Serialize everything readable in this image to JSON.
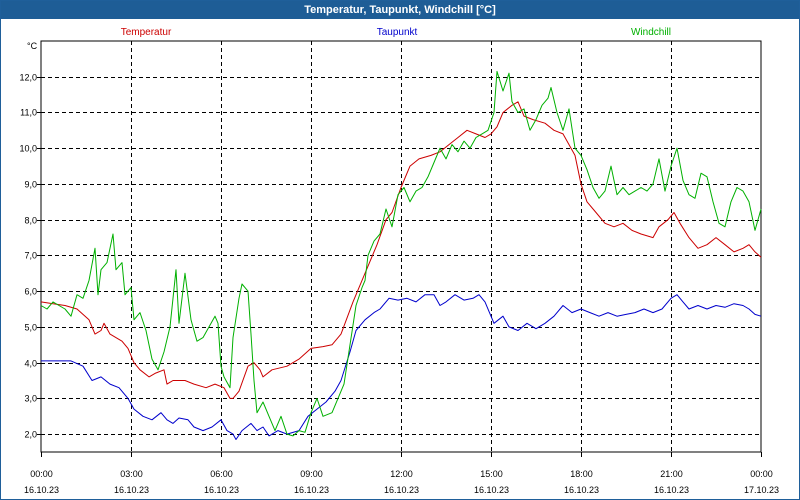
{
  "window": {
    "title": "Temperatur, Taupunkt, Windchill [°C]"
  },
  "chart_data": {
    "type": "line",
    "title": "Temperatur, Taupunkt, Windchill [°C]",
    "ylabel": "°C",
    "ylim": [
      1.5,
      13.0
    ],
    "xlim": [
      0,
      24
    ],
    "yticks": [
      2.0,
      3.0,
      4.0,
      5.0,
      6.0,
      7.0,
      8.0,
      9.0,
      10.0,
      11.0,
      12.0
    ],
    "ytick_labels": [
      "2,0",
      "3,0",
      "4,0",
      "5,0",
      "6,0",
      "7,0",
      "8,0",
      "9,0",
      "10,0",
      "11,0",
      "12,0"
    ],
    "xticks": [
      {
        "x": 0,
        "time": "00:00",
        "date": "16.10.23"
      },
      {
        "x": 3,
        "time": "03:00",
        "date": "16.10.23"
      },
      {
        "x": 6,
        "time": "06:00",
        "date": "16.10.23"
      },
      {
        "x": 9,
        "time": "09:00",
        "date": "16.10.23"
      },
      {
        "x": 12,
        "time": "12:00",
        "date": "16.10.23"
      },
      {
        "x": 15,
        "time": "15:00",
        "date": "16.10.23"
      },
      {
        "x": 18,
        "time": "18:00",
        "date": "16.10.23"
      },
      {
        "x": 21,
        "time": "21:00",
        "date": "16.10.23"
      },
      {
        "x": 24,
        "time": "00:00",
        "date": "17.10.23"
      }
    ],
    "grid": true,
    "legend_position": "top",
    "series": [
      {
        "name": "Temperatur",
        "color": "#cc0000",
        "points": [
          [
            0,
            5.7
          ],
          [
            0.4,
            5.65
          ],
          [
            0.8,
            5.6
          ],
          [
            1.2,
            5.5
          ],
          [
            1.6,
            5.2
          ],
          [
            1.7,
            5.0
          ],
          [
            1.8,
            4.8
          ],
          [
            2.0,
            4.9
          ],
          [
            2.1,
            5.1
          ],
          [
            2.3,
            4.8
          ],
          [
            2.7,
            4.6
          ],
          [
            2.9,
            4.4
          ],
          [
            3.1,
            4.0
          ],
          [
            3.3,
            3.8
          ],
          [
            3.6,
            3.6
          ],
          [
            3.8,
            3.7
          ],
          [
            4.1,
            3.8
          ],
          [
            4.2,
            3.4
          ],
          [
            4.4,
            3.5
          ],
          [
            4.8,
            3.5
          ],
          [
            5.1,
            3.4
          ],
          [
            5.5,
            3.3
          ],
          [
            5.8,
            3.4
          ],
          [
            6.1,
            3.3
          ],
          [
            6.3,
            3.0
          ],
          [
            6.4,
            3.0
          ],
          [
            6.6,
            3.2
          ],
          [
            6.9,
            3.9
          ],
          [
            7.1,
            4.0
          ],
          [
            7.3,
            3.8
          ],
          [
            7.4,
            3.6
          ],
          [
            7.7,
            3.8
          ],
          [
            8.2,
            3.9
          ],
          [
            8.6,
            4.1
          ],
          [
            9.0,
            4.4
          ],
          [
            9.4,
            4.45
          ],
          [
            9.7,
            4.5
          ],
          [
            10.0,
            4.8
          ],
          [
            10.4,
            5.7
          ],
          [
            10.8,
            6.5
          ],
          [
            11.2,
            7.3
          ],
          [
            11.5,
            8.0
          ],
          [
            11.7,
            8.2
          ],
          [
            12.0,
            8.9
          ],
          [
            12.3,
            9.5
          ],
          [
            12.6,
            9.7
          ],
          [
            13.0,
            9.8
          ],
          [
            13.3,
            9.9
          ],
          [
            13.6,
            10.1
          ],
          [
            13.9,
            10.3
          ],
          [
            14.2,
            10.5
          ],
          [
            14.5,
            10.4
          ],
          [
            14.8,
            10.3
          ],
          [
            15.0,
            10.4
          ],
          [
            15.2,
            10.6
          ],
          [
            15.4,
            11.0
          ],
          [
            15.7,
            11.2
          ],
          [
            15.9,
            11.3
          ],
          [
            16.1,
            10.9
          ],
          [
            16.4,
            10.8
          ],
          [
            16.8,
            10.7
          ],
          [
            17.1,
            10.5
          ],
          [
            17.4,
            10.4
          ],
          [
            17.6,
            10.1
          ],
          [
            17.8,
            9.8
          ],
          [
            18.0,
            9.0
          ],
          [
            18.2,
            8.5
          ],
          [
            18.5,
            8.2
          ],
          [
            18.8,
            7.9
          ],
          [
            19.1,
            7.8
          ],
          [
            19.4,
            7.9
          ],
          [
            19.7,
            7.7
          ],
          [
            20.0,
            7.6
          ],
          [
            20.4,
            7.5
          ],
          [
            20.6,
            7.8
          ],
          [
            20.9,
            8.0
          ],
          [
            21.1,
            8.2
          ],
          [
            21.3,
            7.9
          ],
          [
            21.6,
            7.5
          ],
          [
            21.9,
            7.2
          ],
          [
            22.2,
            7.3
          ],
          [
            22.5,
            7.5
          ],
          [
            22.8,
            7.3
          ],
          [
            23.1,
            7.1
          ],
          [
            23.4,
            7.2
          ],
          [
            23.6,
            7.3
          ],
          [
            23.8,
            7.1
          ],
          [
            24.0,
            6.95
          ]
        ]
      },
      {
        "name": "Taupunkt",
        "color": "#0000cc",
        "points": [
          [
            0,
            4.05
          ],
          [
            0.5,
            4.05
          ],
          [
            1.0,
            4.05
          ],
          [
            1.4,
            3.9
          ],
          [
            1.7,
            3.5
          ],
          [
            2.0,
            3.6
          ],
          [
            2.3,
            3.4
          ],
          [
            2.6,
            3.3
          ],
          [
            2.9,
            3.0
          ],
          [
            3.1,
            2.7
          ],
          [
            3.4,
            2.5
          ],
          [
            3.7,
            2.4
          ],
          [
            4.0,
            2.6
          ],
          [
            4.2,
            2.4
          ],
          [
            4.4,
            2.3
          ],
          [
            4.6,
            2.45
          ],
          [
            4.9,
            2.4
          ],
          [
            5.1,
            2.2
          ],
          [
            5.4,
            2.1
          ],
          [
            5.7,
            2.2
          ],
          [
            6.0,
            2.4
          ],
          [
            6.2,
            2.1
          ],
          [
            6.4,
            2.0
          ],
          [
            6.5,
            1.85
          ],
          [
            6.7,
            2.1
          ],
          [
            7.0,
            2.3
          ],
          [
            7.2,
            2.1
          ],
          [
            7.4,
            2.2
          ],
          [
            7.6,
            1.95
          ],
          [
            7.9,
            2.1
          ],
          [
            8.2,
            2.0
          ],
          [
            8.6,
            2.1
          ],
          [
            8.9,
            2.5
          ],
          [
            9.2,
            2.7
          ],
          [
            9.5,
            2.9
          ],
          [
            9.8,
            3.2
          ],
          [
            10.0,
            3.5
          ],
          [
            10.3,
            4.3
          ],
          [
            10.5,
            4.9
          ],
          [
            10.8,
            5.2
          ],
          [
            11.1,
            5.4
          ],
          [
            11.3,
            5.5
          ],
          [
            11.6,
            5.8
          ],
          [
            11.9,
            5.75
          ],
          [
            12.2,
            5.8
          ],
          [
            12.5,
            5.7
          ],
          [
            12.8,
            5.9
          ],
          [
            13.1,
            5.9
          ],
          [
            13.3,
            5.6
          ],
          [
            13.5,
            5.7
          ],
          [
            13.8,
            5.9
          ],
          [
            14.1,
            5.75
          ],
          [
            14.4,
            5.8
          ],
          [
            14.6,
            5.9
          ],
          [
            14.8,
            5.7
          ],
          [
            15.1,
            5.1
          ],
          [
            15.4,
            5.3
          ],
          [
            15.6,
            5.0
          ],
          [
            15.9,
            4.9
          ],
          [
            16.2,
            5.1
          ],
          [
            16.5,
            4.95
          ],
          [
            16.8,
            5.1
          ],
          [
            17.1,
            5.3
          ],
          [
            17.4,
            5.6
          ],
          [
            17.7,
            5.4
          ],
          [
            18.0,
            5.5
          ],
          [
            18.3,
            5.4
          ],
          [
            18.6,
            5.3
          ],
          [
            18.9,
            5.4
          ],
          [
            19.2,
            5.3
          ],
          [
            19.5,
            5.35
          ],
          [
            19.8,
            5.4
          ],
          [
            20.1,
            5.5
          ],
          [
            20.4,
            5.4
          ],
          [
            20.7,
            5.5
          ],
          [
            21.0,
            5.8
          ],
          [
            21.2,
            5.9
          ],
          [
            21.4,
            5.7
          ],
          [
            21.6,
            5.5
          ],
          [
            21.9,
            5.6
          ],
          [
            22.2,
            5.5
          ],
          [
            22.5,
            5.6
          ],
          [
            22.8,
            5.55
          ],
          [
            23.1,
            5.65
          ],
          [
            23.4,
            5.6
          ],
          [
            23.6,
            5.5
          ],
          [
            23.8,
            5.35
          ],
          [
            24.0,
            5.3
          ]
        ]
      },
      {
        "name": "Windchill",
        "color": "#00b000",
        "points": [
          [
            0,
            5.6
          ],
          [
            0.2,
            5.5
          ],
          [
            0.4,
            5.7
          ],
          [
            0.6,
            5.6
          ],
          [
            0.8,
            5.5
          ],
          [
            1.0,
            5.3
          ],
          [
            1.2,
            5.9
          ],
          [
            1.4,
            5.8
          ],
          [
            1.6,
            6.3
          ],
          [
            1.8,
            7.2
          ],
          [
            1.9,
            5.9
          ],
          [
            2.0,
            6.6
          ],
          [
            2.2,
            6.8
          ],
          [
            2.4,
            7.6
          ],
          [
            2.5,
            6.6
          ],
          [
            2.7,
            6.8
          ],
          [
            2.8,
            5.9
          ],
          [
            3.0,
            6.1
          ],
          [
            3.1,
            5.2
          ],
          [
            3.3,
            5.4
          ],
          [
            3.5,
            4.9
          ],
          [
            3.7,
            4.1
          ],
          [
            3.9,
            3.8
          ],
          [
            4.1,
            4.3
          ],
          [
            4.3,
            5.0
          ],
          [
            4.5,
            6.6
          ],
          [
            4.6,
            5.1
          ],
          [
            4.8,
            6.5
          ],
          [
            5.0,
            5.2
          ],
          [
            5.2,
            4.6
          ],
          [
            5.4,
            4.7
          ],
          [
            5.6,
            5.0
          ],
          [
            5.8,
            5.3
          ],
          [
            5.9,
            5.1
          ],
          [
            6.0,
            3.9
          ],
          [
            6.1,
            3.6
          ],
          [
            6.3,
            3.3
          ],
          [
            6.4,
            4.7
          ],
          [
            6.6,
            5.8
          ],
          [
            6.7,
            6.2
          ],
          [
            6.9,
            6.0
          ],
          [
            7.0,
            4.8
          ],
          [
            7.1,
            3.5
          ],
          [
            7.2,
            2.6
          ],
          [
            7.4,
            2.9
          ],
          [
            7.6,
            2.5
          ],
          [
            7.8,
            2.1
          ],
          [
            8.0,
            2.5
          ],
          [
            8.2,
            2.0
          ],
          [
            8.4,
            1.95
          ],
          [
            8.6,
            2.1
          ],
          [
            8.8,
            2.05
          ],
          [
            9.0,
            2.6
          ],
          [
            9.2,
            3.0
          ],
          [
            9.4,
            2.5
          ],
          [
            9.7,
            2.6
          ],
          [
            9.9,
            3.0
          ],
          [
            10.1,
            3.4
          ],
          [
            10.3,
            4.5
          ],
          [
            10.5,
            5.6
          ],
          [
            10.7,
            6.1
          ],
          [
            10.8,
            6.3
          ],
          [
            10.9,
            7.0
          ],
          [
            11.1,
            7.4
          ],
          [
            11.3,
            7.6
          ],
          [
            11.5,
            8.3
          ],
          [
            11.7,
            7.8
          ],
          [
            11.9,
            8.7
          ],
          [
            12.1,
            8.9
          ],
          [
            12.3,
            8.5
          ],
          [
            12.5,
            8.8
          ],
          [
            12.7,
            8.9
          ],
          [
            12.9,
            9.2
          ],
          [
            13.1,
            9.6
          ],
          [
            13.3,
            10.0
          ],
          [
            13.5,
            9.7
          ],
          [
            13.7,
            10.1
          ],
          [
            13.9,
            9.9
          ],
          [
            14.1,
            10.2
          ],
          [
            14.3,
            10.0
          ],
          [
            14.5,
            10.3
          ],
          [
            14.7,
            10.4
          ],
          [
            14.9,
            10.5
          ],
          [
            15.1,
            11.0
          ],
          [
            15.2,
            12.15
          ],
          [
            15.4,
            11.6
          ],
          [
            15.6,
            12.1
          ],
          [
            15.7,
            11.3
          ],
          [
            15.9,
            11.0
          ],
          [
            16.1,
            11.1
          ],
          [
            16.3,
            10.5
          ],
          [
            16.5,
            10.8
          ],
          [
            16.7,
            11.2
          ],
          [
            16.9,
            11.4
          ],
          [
            17.0,
            11.7
          ],
          [
            17.2,
            11.0
          ],
          [
            17.4,
            10.5
          ],
          [
            17.6,
            11.1
          ],
          [
            17.8,
            10.0
          ],
          [
            18.0,
            9.8
          ],
          [
            18.2,
            9.4
          ],
          [
            18.4,
            8.9
          ],
          [
            18.6,
            8.6
          ],
          [
            18.8,
            8.8
          ],
          [
            19.0,
            9.5
          ],
          [
            19.2,
            8.7
          ],
          [
            19.4,
            8.9
          ],
          [
            19.6,
            8.7
          ],
          [
            19.8,
            8.8
          ],
          [
            20.0,
            8.9
          ],
          [
            20.2,
            8.8
          ],
          [
            20.4,
            9.0
          ],
          [
            20.6,
            9.7
          ],
          [
            20.8,
            8.8
          ],
          [
            21.0,
            9.5
          ],
          [
            21.2,
            10.0
          ],
          [
            21.4,
            9.1
          ],
          [
            21.6,
            8.7
          ],
          [
            21.8,
            8.6
          ],
          [
            22.0,
            9.3
          ],
          [
            22.2,
            9.2
          ],
          [
            22.4,
            8.5
          ],
          [
            22.6,
            7.9
          ],
          [
            22.8,
            7.8
          ],
          [
            23.0,
            8.5
          ],
          [
            23.2,
            8.9
          ],
          [
            23.4,
            8.8
          ],
          [
            23.6,
            8.5
          ],
          [
            23.8,
            7.7
          ],
          [
            24.0,
            8.3
          ]
        ]
      }
    ]
  }
}
